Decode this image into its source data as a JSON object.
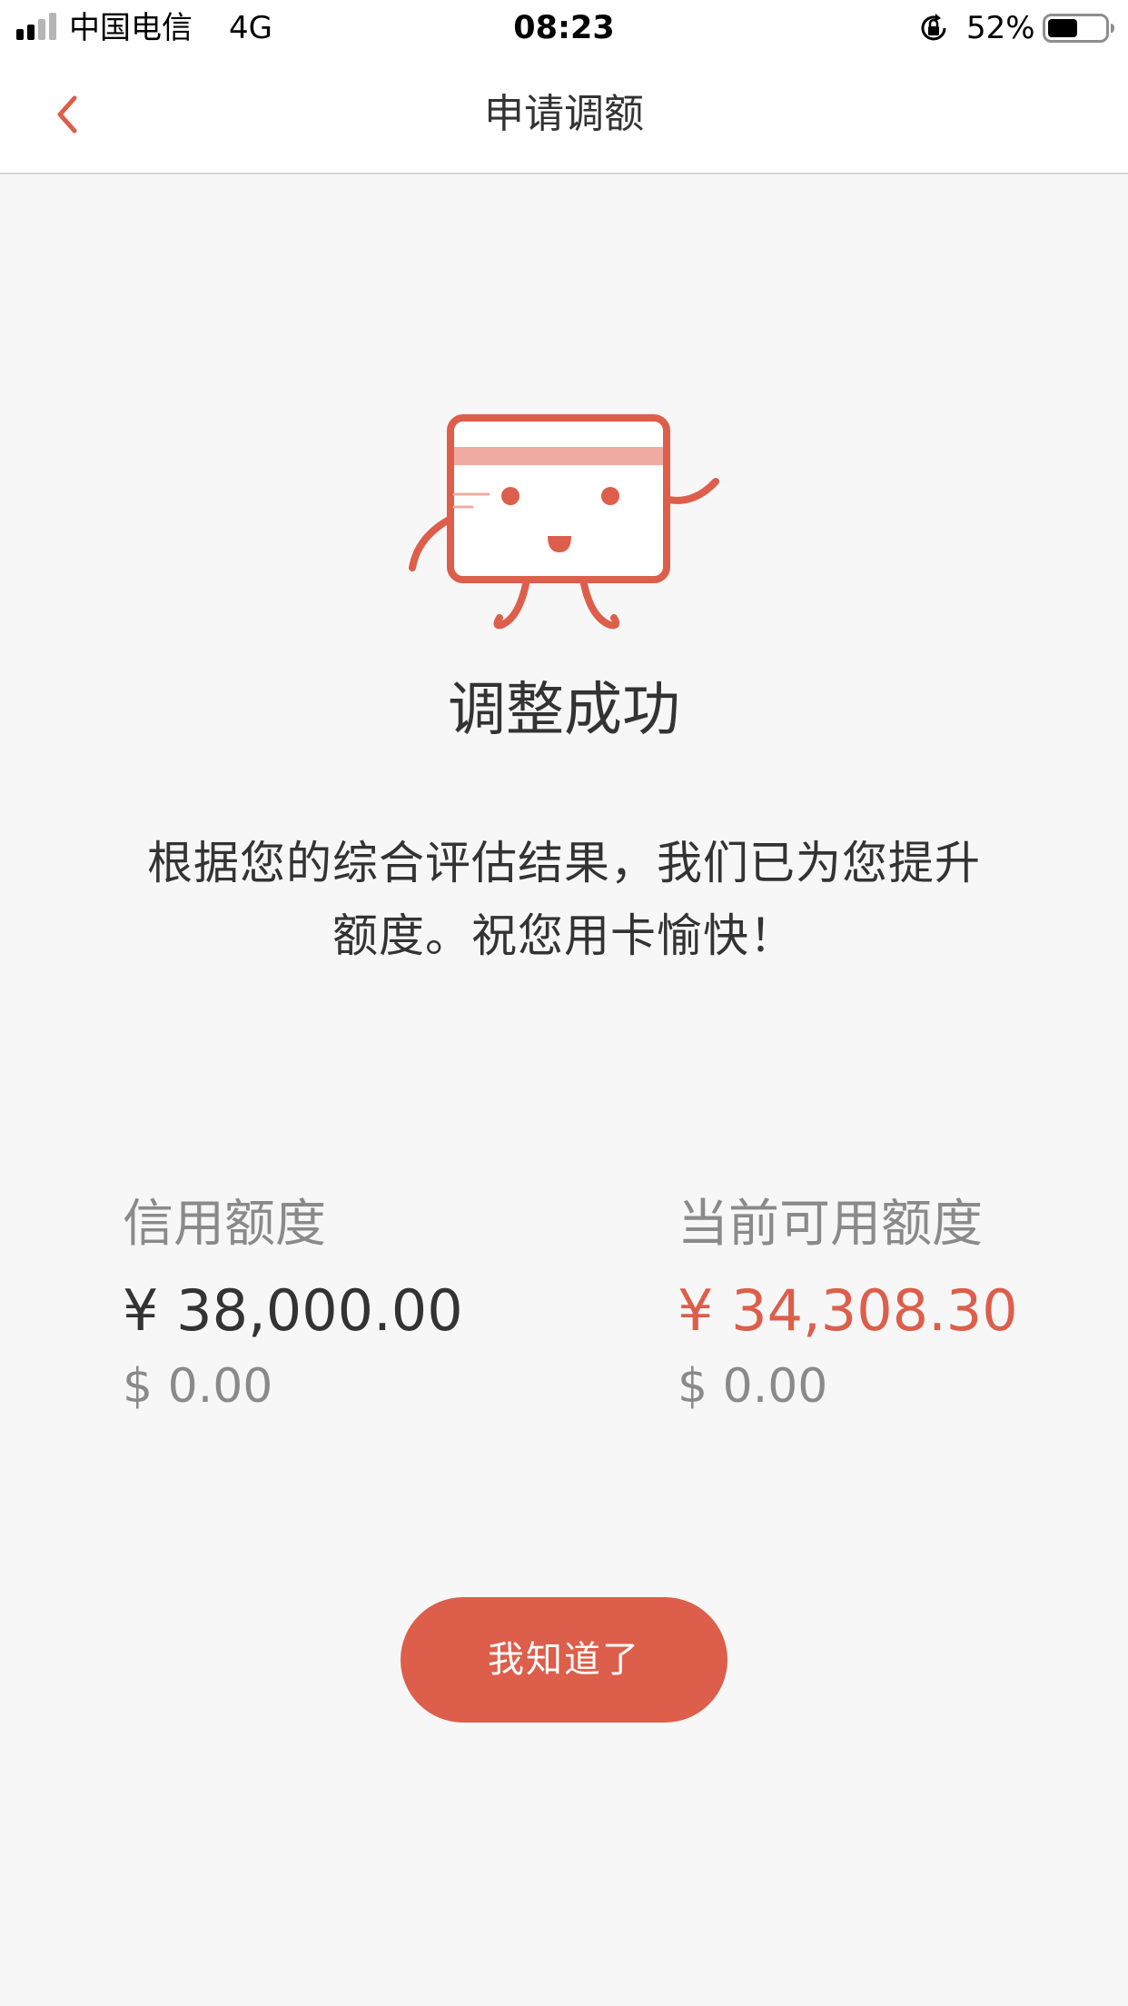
{
  "status_bar": {
    "carrier": "中国电信",
    "network": "4G",
    "time": "08:23",
    "battery_percent": "52%",
    "battery_level": 0.52,
    "signal_bars_active": 2,
    "signal_bars_total": 4
  },
  "nav": {
    "title": "申请调额",
    "back_icon": "chevron-left-icon"
  },
  "result": {
    "title": "调整成功",
    "message": "根据您的综合评估结果，我们已为您提升额度。祝您用卡愉快！"
  },
  "amounts": {
    "credit_limit": {
      "label": "信用额度",
      "cny": "¥ 38,000.00",
      "usd": "$ 0.00"
    },
    "available_limit": {
      "label": "当前可用额度",
      "cny": "¥ 34,308.30",
      "usd": "$ 0.00"
    }
  },
  "button": {
    "label": "我知道了"
  },
  "colors": {
    "accent": "#dd5e4a",
    "accent_light": "#f0aba0",
    "text_primary": "#333333",
    "text_secondary": "#8a8a8a",
    "background": "#f7f7f7"
  }
}
